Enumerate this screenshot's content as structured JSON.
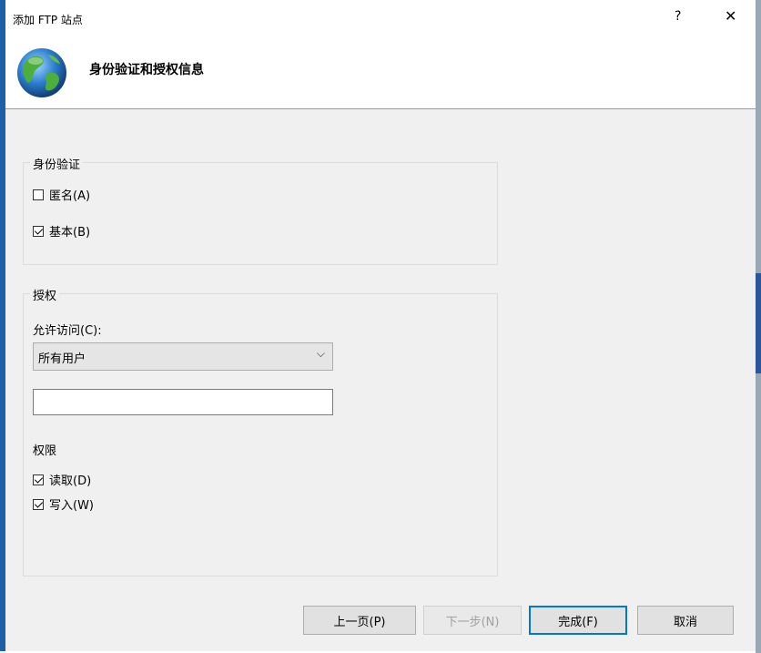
{
  "window": {
    "title": "添加 FTP 站点",
    "help_label": "?",
    "close_label": "✕"
  },
  "header": {
    "title": "身份验证和授权信息",
    "icon": "globe-icon"
  },
  "authentication": {
    "legend": "身份验证",
    "anonymous": {
      "label": "匿名(A)",
      "checked": false
    },
    "basic": {
      "label": "基本(B)",
      "checked": true
    }
  },
  "authorization": {
    "legend": "授权",
    "allow_access_label": "允许访问(C):",
    "allow_access_value": "所有用户",
    "textbox_value": "",
    "permissions_label": "权限",
    "read": {
      "label": "读取(D)",
      "checked": true
    },
    "write": {
      "label": "写入(W)",
      "checked": true
    }
  },
  "buttons": {
    "previous": "上一页(P)",
    "next": "下一步(N)",
    "finish": "完成(F)",
    "cancel": "取消"
  },
  "colors": {
    "accent": "#0078d7",
    "panel_bg": "#f0f0f0",
    "window_edge": "#1f5fa8"
  }
}
